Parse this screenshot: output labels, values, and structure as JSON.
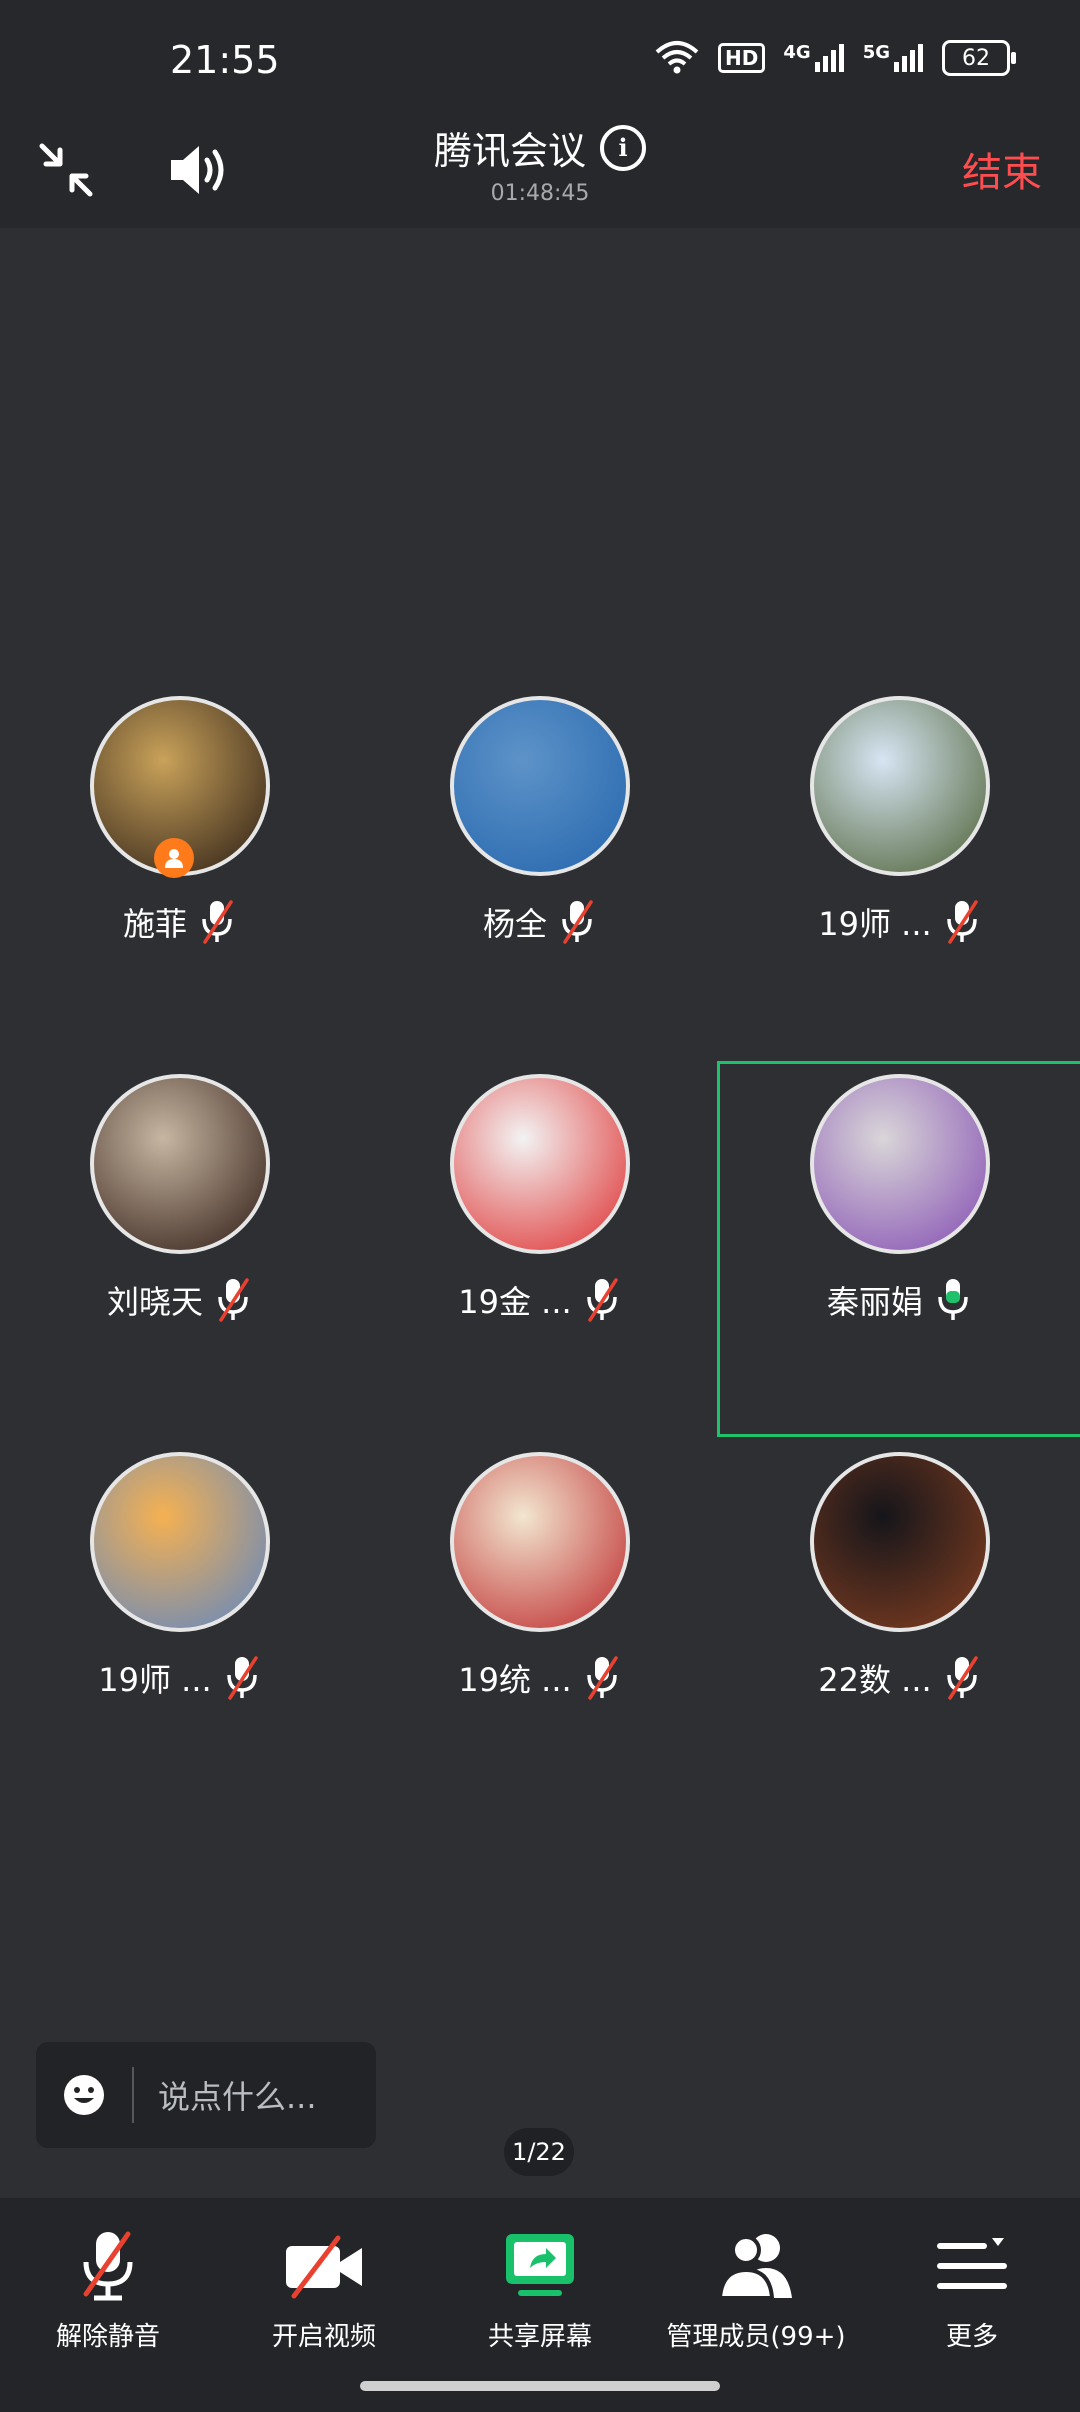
{
  "status_bar": {
    "time": "21:55",
    "network_hd": "HD",
    "network_4g": "4G",
    "network_5g": "5G",
    "battery": "62"
  },
  "header": {
    "title": "腾讯会议",
    "timer": "01:48:45",
    "end_label": "结束"
  },
  "participants": [
    {
      "name": "施菲",
      "mic": "muted",
      "host": true,
      "avatar_colors": [
        "#c9a25a",
        "#3a2a1c"
      ]
    },
    {
      "name": "杨全",
      "mic": "muted",
      "host": false,
      "avatar_colors": [
        "#5d93c8",
        "#2a6ab0"
      ]
    },
    {
      "name": "19师 ...",
      "mic": "muted",
      "host": false,
      "avatar_colors": [
        "#d6e5f3",
        "#5a6d46"
      ]
    },
    {
      "name": "刘晓天",
      "mic": "muted",
      "host": false,
      "avatar_colors": [
        "#c7b6a2",
        "#3e2a22"
      ]
    },
    {
      "name": "19金 ...",
      "mic": "muted",
      "host": false,
      "avatar_colors": [
        "#f3f3f3",
        "#e04040"
      ]
    },
    {
      "name": "秦丽娟",
      "mic": "speaking",
      "host": false,
      "avatar_colors": [
        "#d9d6d8",
        "#8c5ab6"
      ]
    },
    {
      "name": "19师 ...",
      "mic": "muted",
      "host": false,
      "avatar_colors": [
        "#f5b152",
        "#6c8ab8"
      ]
    },
    {
      "name": "19统 ...",
      "mic": "muted",
      "host": false,
      "avatar_colors": [
        "#f2e6d0",
        "#c23a3a"
      ]
    },
    {
      "name": "22数 ...",
      "mic": "muted",
      "host": false,
      "avatar_colors": [
        "#15151a",
        "#7a3b20"
      ]
    }
  ],
  "chat": {
    "placeholder": "说点什么..."
  },
  "pager": "1/22",
  "toolbar": {
    "unmute": "解除静音",
    "video": "开启视频",
    "share": "共享屏幕",
    "members": "管理成员(99+)",
    "more": "更多"
  },
  "colors": {
    "speaking_green": "#1fc26a",
    "end_red": "#ff4d4f",
    "share_green": "#19c16b",
    "mute_red": "#e8412f",
    "host_badge": "#ff7a1a"
  }
}
